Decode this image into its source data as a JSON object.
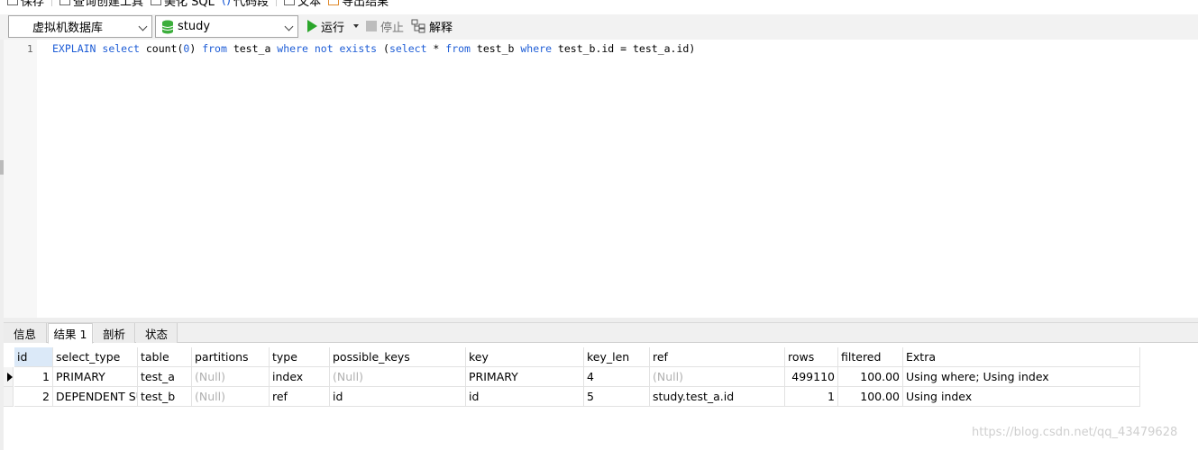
{
  "toolbar_top": {
    "items": [
      "保存",
      "查询创建工具",
      "美化 SQL",
      "代码段",
      "文本",
      "导出结果"
    ]
  },
  "toolbar": {
    "connection": "虚拟机数据库",
    "database": "study",
    "run_label": "运行",
    "stop_label": "停止",
    "explain_label": "解释"
  },
  "editor": {
    "line_number": "1",
    "sql": [
      {
        "t": "EXPLAIN ",
        "k": true
      },
      {
        "t": "select ",
        "k": true
      },
      {
        "t": "count(",
        "k": false
      },
      {
        "t": "0",
        "k": true
      },
      {
        "t": ") ",
        "k": false
      },
      {
        "t": "from ",
        "k": true
      },
      {
        "t": "test_a ",
        "k": false
      },
      {
        "t": "where ",
        "k": true
      },
      {
        "t": "not ",
        "k": true
      },
      {
        "t": "exists ",
        "k": true
      },
      {
        "t": "(",
        "k": false
      },
      {
        "t": "select ",
        "k": true
      },
      {
        "t": "* ",
        "k": false
      },
      {
        "t": "from ",
        "k": true
      },
      {
        "t": "test_b ",
        "k": false
      },
      {
        "t": "where ",
        "k": true
      },
      {
        "t": "test_b.id = test_a.id)",
        "k": false
      }
    ]
  },
  "tabs": [
    "信息",
    "结果 1",
    "剖析",
    "状态"
  ],
  "active_tab": 1,
  "grid": {
    "columns": [
      "id",
      "select_type",
      "table",
      "partitions",
      "type",
      "possible_keys",
      "key",
      "key_len",
      "ref",
      "rows",
      "filtered",
      "Extra"
    ],
    "rows": [
      [
        "1",
        "PRIMARY",
        "test_a",
        "(Null)",
        "index",
        "(Null)",
        "PRIMARY",
        "4",
        "(Null)",
        "499110",
        "100.00",
        "Using where; Using index"
      ],
      [
        "2",
        "DEPENDENT SUBQUERY",
        "test_b",
        "(Null)",
        "ref",
        "id",
        "id",
        "5",
        "study.test_a.id",
        "1",
        "100.00",
        "Using index"
      ]
    ],
    "current_row": 0
  },
  "watermark": "https://blog.csdn.net/qq_43479628",
  "colors": {
    "keyword": "#1e5dd6",
    "run_icon": "#2aa52a",
    "null_text": "#b0b0b0",
    "header_selected": "#dbe9f8"
  }
}
